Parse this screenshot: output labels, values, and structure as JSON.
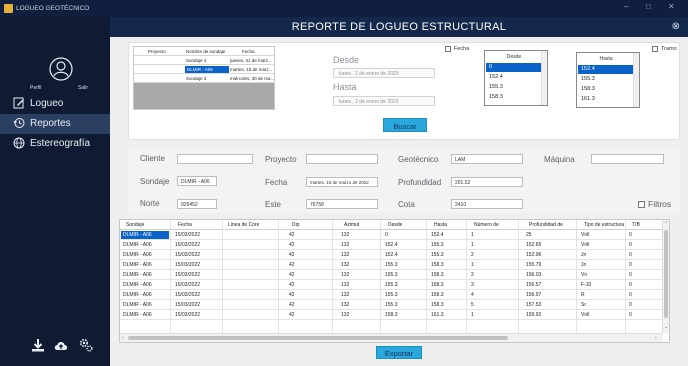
{
  "window": {
    "title": "LOGUEO GEOTÉCNICO",
    "minimize": "–",
    "maximize": "□",
    "close": "✕"
  },
  "header": {
    "title": "REPORTE DE LOGUEO ESTRUCTURAL",
    "close_icon": "⊗"
  },
  "sidebar": {
    "profile_label": "Perfil",
    "exit_label": "Salir",
    "items": [
      {
        "label": "Logueo",
        "icon": "edit-icon"
      },
      {
        "label": "Reportes",
        "icon": "history-icon"
      },
      {
        "label": "Estereografía",
        "icon": "globe-icon"
      }
    ],
    "bottom_icons": [
      "download-icon",
      "cloud-upload-icon",
      "settings-icon"
    ]
  },
  "filter": {
    "mini_grid": {
      "headers": [
        "Proyecto",
        "Nombre de sondaje",
        "Fecha"
      ],
      "rows": [
        {
          "proyecto": "",
          "sondaje": "Sondaje 4",
          "fecha": "jueves, 31 de marz..."
        },
        {
          "proyecto": "",
          "sondaje": "DLMIR - A06",
          "fecha": "martes, 15 de marz..."
        },
        {
          "proyecto": "",
          "sondaje": "Sondaje 3",
          "fecha": "miércoles, 30 de ma..."
        }
      ]
    },
    "desde_label": "Desde",
    "hasta_label": "Hasta",
    "desde_value": "lunes , 2 de enero de 2023",
    "hasta_value": "lunes , 2 de enero de 2023",
    "fecha_checkbox": "Fecha",
    "tramo_checkbox": "Tramo",
    "desde_list": {
      "header": "Desde",
      "items": [
        "0",
        "152.4",
        "155.3",
        "158.3"
      ],
      "selected": 0
    },
    "hasta_list": {
      "header": "Hasta",
      "items": [
        "152.4",
        "155.3",
        "158.3",
        "161.3"
      ],
      "selected": 0
    },
    "buscar_label": "Buscar"
  },
  "form": {
    "cliente_label": "Cliente",
    "cliente_value": "",
    "proyecto_label": "Proyecto",
    "proyecto_value": "",
    "geotecnico_label": "Geotécnico",
    "geotecnico_value": "LAM",
    "maquina_label": "Máquina",
    "maquina_value": "",
    "sondaje_label": "Sondaje",
    "sondaje_value": "DLMIR - A06",
    "fecha_label": "Fecha",
    "fecha_value": "martes, 15 de marzo de 2022",
    "profundidad_label": "Profundidad",
    "profundidad_value": "201.52",
    "norte_label": "Norte",
    "norte_value": "925452",
    "este_label": "Este",
    "este_value": "76758",
    "cota_label": "Cota",
    "cota_value": "2410",
    "filtros_label": "Filtros"
  },
  "table": {
    "columns": [
      "Sondaje",
      "Fecha",
      "Linea de Core",
      "Dip",
      "Azimut",
      "Desde",
      "Hasta",
      "Número de",
      "Profundidad de",
      "Tipo de estructura",
      "T/B"
    ],
    "rows": [
      [
        "DLMIR - A06",
        "15/03/2022",
        "",
        "42",
        "132",
        "0",
        "152.4",
        "1",
        "25",
        "Vnll",
        "0"
      ],
      [
        "DLMIR - A06",
        "15/03/2022",
        "",
        "42",
        "132",
        "152.4",
        "155.3",
        "1",
        "152.65",
        "Vnll",
        "0"
      ],
      [
        "DLMIR - A06",
        "15/03/2022",
        "",
        "42",
        "132",
        "152.4",
        "155.3",
        "2",
        "152.96",
        "Jn",
        "0"
      ],
      [
        "DLMIR - A06",
        "15/03/2022",
        "",
        "42",
        "132",
        "155.3",
        "158.3",
        "1",
        "155.79",
        "Jn",
        "0"
      ],
      [
        "DLMIR - A06",
        "15/03/2022",
        "",
        "42",
        "132",
        "155.3",
        "158.3",
        "2",
        "156.03",
        "Vn",
        "0"
      ],
      [
        "DLMIR - A06",
        "15/03/2022",
        "",
        "42",
        "132",
        "155.3",
        "158.3",
        "3",
        "156.57",
        "F-10",
        "0"
      ],
      [
        "DLMIR - A06",
        "15/03/2022",
        "",
        "42",
        "132",
        "155.3",
        "158.3",
        "4",
        "156.97",
        "R",
        "0"
      ],
      [
        "DLMIR - A06",
        "15/03/2022",
        "",
        "42",
        "132",
        "155.3",
        "158.3",
        "5",
        "157.53",
        "Sr",
        "0"
      ],
      [
        "DLMIR - A06",
        "15/03/2022",
        "",
        "42",
        "132",
        "158.3",
        "161.3",
        "1",
        "159.92",
        "Vnll",
        "0"
      ]
    ]
  },
  "exportar_label": "Exportar",
  "colors": {
    "sidebar": "#0e1b33",
    "header": "#13284a",
    "accent": "#2aa8dc",
    "selection": "#0a63c9"
  }
}
